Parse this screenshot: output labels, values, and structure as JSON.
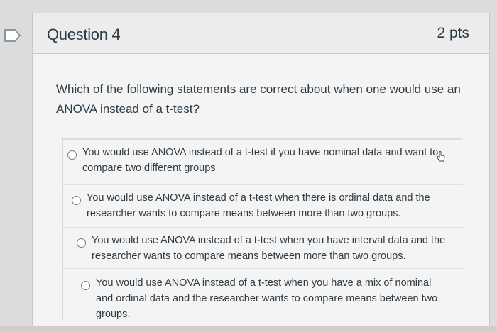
{
  "question": {
    "title": "Question 4",
    "points": "2 pts",
    "text": "Which of the following statements are correct about when one would use an ANOVA instead of a t-test?"
  },
  "answers": [
    {
      "label": "You would use ANOVA instead of a t-test if you have nominal data and want to compare two different groups",
      "selected": false
    },
    {
      "label": "You would use ANOVA instead of a t-test when there is ordinal data and the researcher wants to compare means between more than two groups.",
      "selected": false
    },
    {
      "label": "You would use ANOVA instead of a t-test when you have interval data and the researcher wants to compare means between more than two groups.",
      "selected": false
    },
    {
      "label": "You would use ANOVA instead of a t-test when you have a mix of nominal and ordinal data and the researcher wants to compare means between two groups.",
      "selected": false
    }
  ],
  "icons": {
    "bookmark": "bookmark-icon",
    "radio": "radio-unselected-icon",
    "cursor": "hand-pointer-icon"
  },
  "colors": {
    "text": "#2d3b45",
    "card_background": "#f4f4f4",
    "header_background": "#ececec",
    "bookmark_stroke": "#8a96a0"
  }
}
